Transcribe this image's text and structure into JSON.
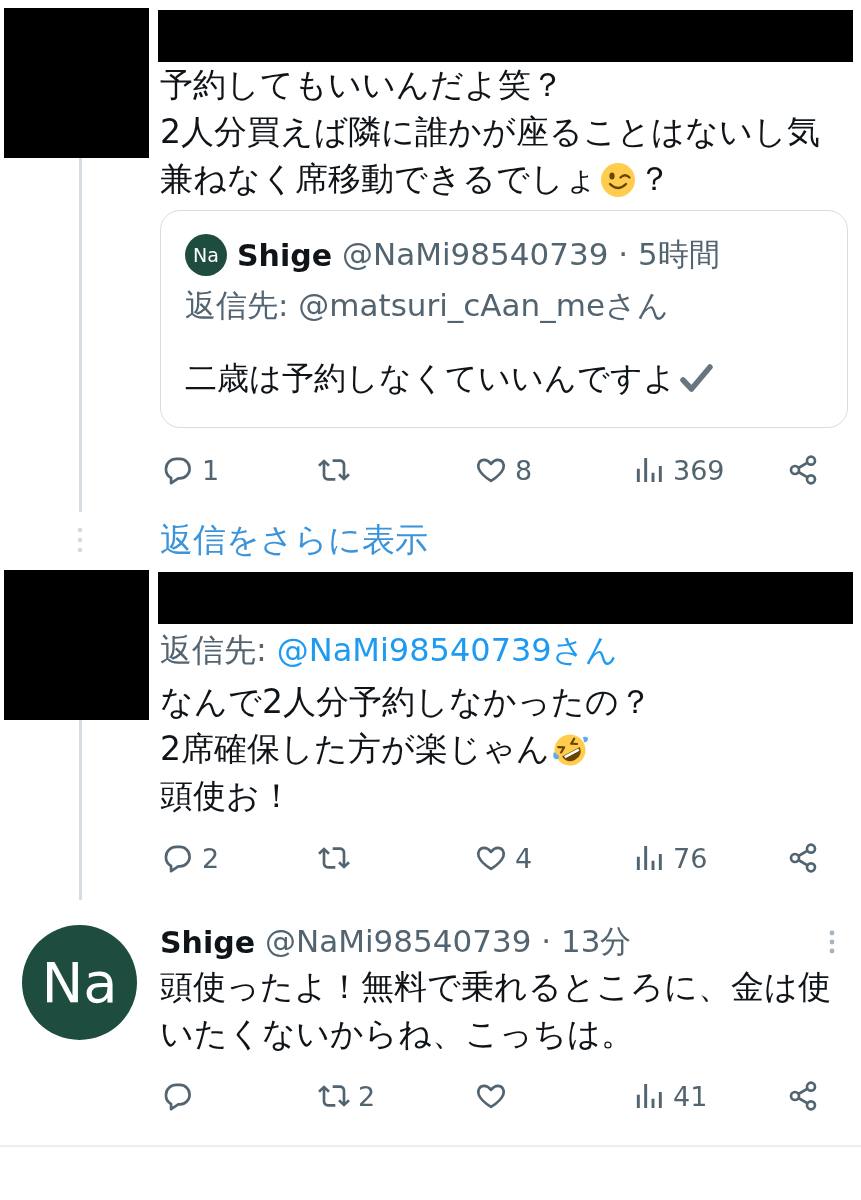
{
  "thread": [
    {
      "kind": "tweet",
      "avatar": {
        "kind": "redacted"
      },
      "header": {
        "kind": "redacted"
      },
      "thread_line": true,
      "lines": [
        [
          {
            "kind": "text",
            "text": "予約してもいいんだよ笑？"
          }
        ],
        [
          {
            "kind": "text",
            "text": "2人分買えば隣に誰かが座ることはないし気"
          }
        ],
        [
          {
            "kind": "text",
            "text": "兼ねなく席移動できるでしょ"
          },
          {
            "kind": "wink"
          },
          {
            "kind": "text",
            "text": "？"
          }
        ]
      ],
      "quote": {
        "avatar": {
          "kind": "initials",
          "text": "Na"
        },
        "name": "Shige",
        "meta": "@NaMi98540739 · 5時間",
        "reply_to": "返信先: @matsuri_cAan_meさん",
        "lines": [
          [
            {
              "kind": "text",
              "text": "二歳は予約しなくていいんですよ"
            },
            {
              "kind": "check"
            }
          ]
        ]
      },
      "actions": [
        {
          "kind": "reply",
          "count": "1"
        },
        {
          "kind": "repost"
        },
        {
          "kind": "like",
          "count": "8"
        },
        {
          "kind": "views",
          "count": "369"
        },
        {
          "kind": "share"
        }
      ]
    },
    {
      "kind": "show_more",
      "label": "返信をさらに表示"
    },
    {
      "kind": "tweet",
      "avatar": {
        "kind": "redacted"
      },
      "header": {
        "kind": "redacted"
      },
      "thread_line": true,
      "reply_to": {
        "label": "返信先:",
        "mention": "@NaMi98540739さん"
      },
      "lines": [
        [
          {
            "kind": "text",
            "text": "なんで2人分予約しなかったの？"
          }
        ],
        [
          {
            "kind": "text",
            "text": "2席確保した方が楽じゃん"
          },
          {
            "kind": "rofl"
          }
        ],
        [
          {
            "kind": "text",
            "text": "頭使お！"
          }
        ]
      ],
      "actions": [
        {
          "kind": "reply",
          "count": "2"
        },
        {
          "kind": "repost"
        },
        {
          "kind": "like",
          "count": "4"
        },
        {
          "kind": "views",
          "count": "76"
        },
        {
          "kind": "share"
        }
      ]
    },
    {
      "kind": "tweet",
      "avatar": {
        "kind": "initials",
        "text": "Na"
      },
      "header": {
        "kind": "user",
        "name": "Shige",
        "meta": "@NaMi98540739 · 13分"
      },
      "more_menu": true,
      "lines": [
        [
          {
            "kind": "text",
            "text": "頭使ったよ！無料で乗れるところに、金は使"
          }
        ],
        [
          {
            "kind": "text",
            "text": "いたくないからね、こっちは。"
          }
        ]
      ],
      "actions": [
        {
          "kind": "reply"
        },
        {
          "kind": "repost",
          "count": "2"
        },
        {
          "kind": "like"
        },
        {
          "kind": "views",
          "count": "41"
        },
        {
          "kind": "share"
        }
      ]
    }
  ]
}
